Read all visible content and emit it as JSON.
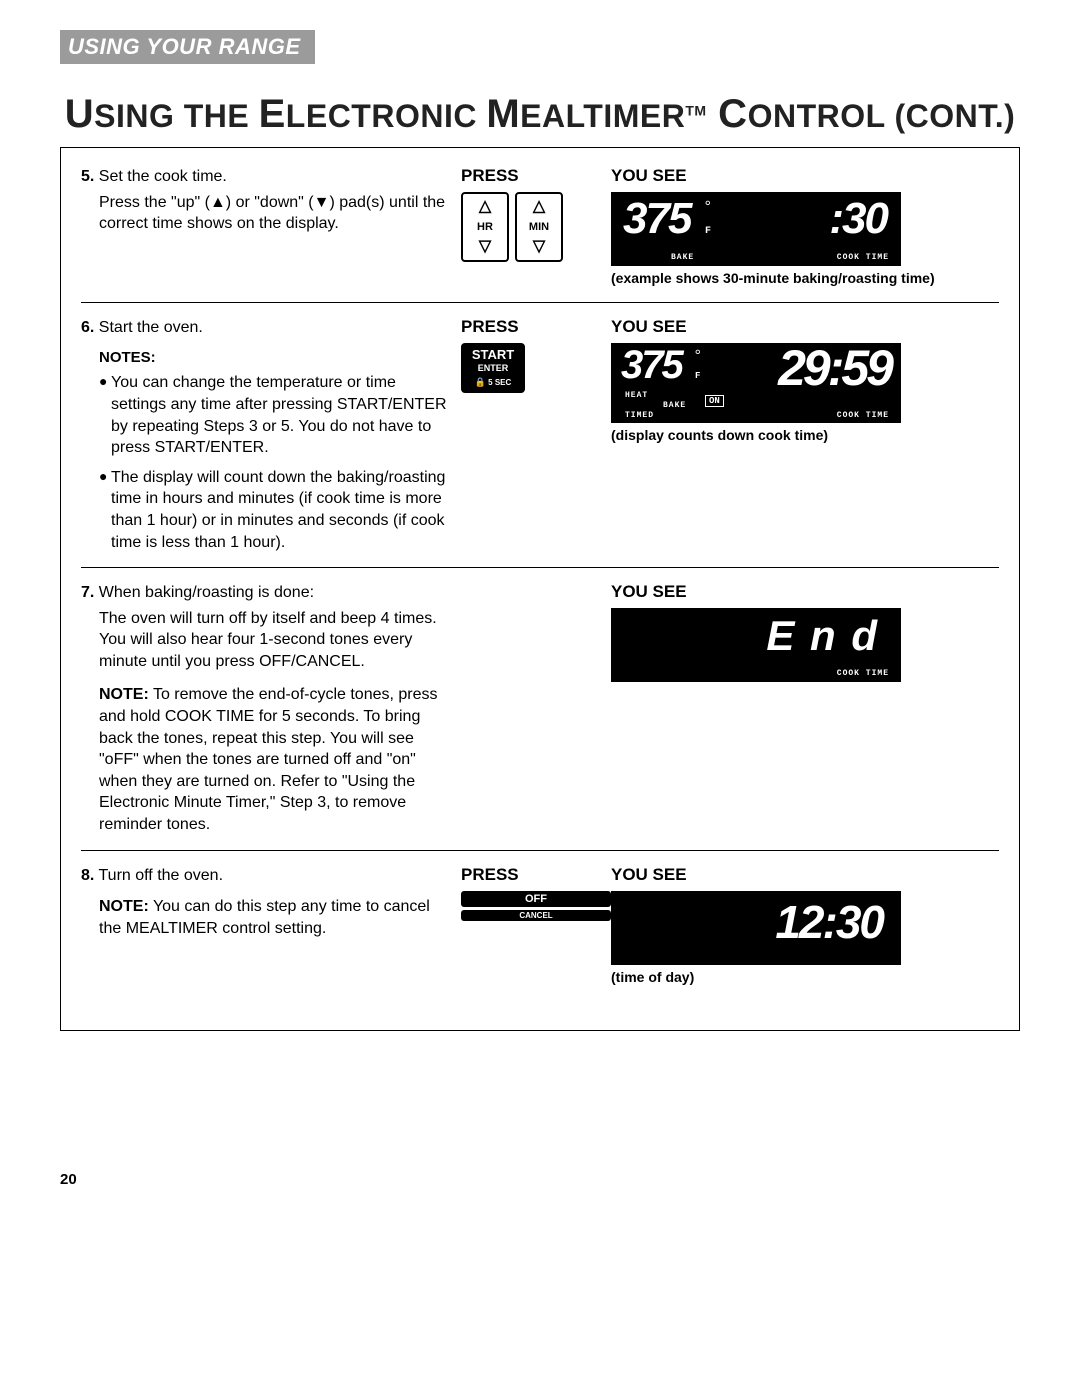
{
  "section_header": "USING YOUR RANGE",
  "title_pre": "U",
  "title_mid1": "SING THE ",
  "title_big1": "E",
  "title_mid2": "LECTRONIC ",
  "title_big2": "M",
  "title_mid3": "EALTIMER",
  "title_tm": "TM",
  "title_big3": " C",
  "title_mid4": "ONTROL ",
  "title_cont": "(CONT.)",
  "press_label": "PRESS",
  "yousee_label": "YOU SEE",
  "steps": {
    "s5": {
      "num": "5.",
      "title": "Set the cook time.",
      "body": "Press the \"up\" (▲) or \"down\" (▼) pad(s) until the correct time shows on the display.",
      "pad_hr": "HR",
      "pad_min": "MIN",
      "display_temp": "375",
      "display_unit": "F",
      "display_time": ":30",
      "label_bake": "BAKE",
      "label_cooktime": "COOK  TIME",
      "caption": "(example shows 30-minute baking/roasting time)"
    },
    "s6": {
      "num": "6.",
      "title": "Start the oven.",
      "notes_label": "NOTES:",
      "note1": "You can change the temperature or time settings any time after pressing START/ENTER by repeating Steps 3 or 5. You do not have to press START/ENTER.",
      "note2": "The display will count down the baking/roasting time in hours and minutes (if cook time is more than 1 hour) or in minutes and seconds (if cook time is less than 1 hour).",
      "btn_start": "START",
      "btn_enter": "ENTER",
      "btn_hold": "5 SEC",
      "display_temp": "375",
      "display_unit": "F",
      "display_time": "29:59",
      "label_heat": "HEAT",
      "label_bake": "BAKE",
      "label_on": "ON",
      "label_timed": "TIMED",
      "label_cooktime": "COOK  TIME",
      "caption": "(display counts down cook time)"
    },
    "s7": {
      "num": "7.",
      "title": "When baking/roasting is done:",
      "body1": "The oven will turn off by itself and beep 4 times. You will also hear four 1-second tones every minute until you press OFF/CANCEL.",
      "note_label": "NOTE:",
      "body2": " To remove the end-of-cycle tones, press and hold COOK TIME for 5 seconds. To bring back the tones, repeat this step. You will see \"oFF\" when the tones are turned off and \"on\" when they are turned on. Refer to \"Using the Electronic Minute Timer,\" Step 3, to remove reminder tones.",
      "display_text": "E n d",
      "label_cooktime": "COOK  TIME"
    },
    "s8": {
      "num": "8.",
      "title": "Turn off the oven.",
      "note_label": "NOTE:",
      "body": " You can do this step any time to cancel the MEALTIMER control setting.",
      "btn_off": "OFF",
      "btn_cancel": "CANCEL",
      "display_time": "12:30",
      "caption": "(time of day)"
    }
  },
  "page_number": "20"
}
